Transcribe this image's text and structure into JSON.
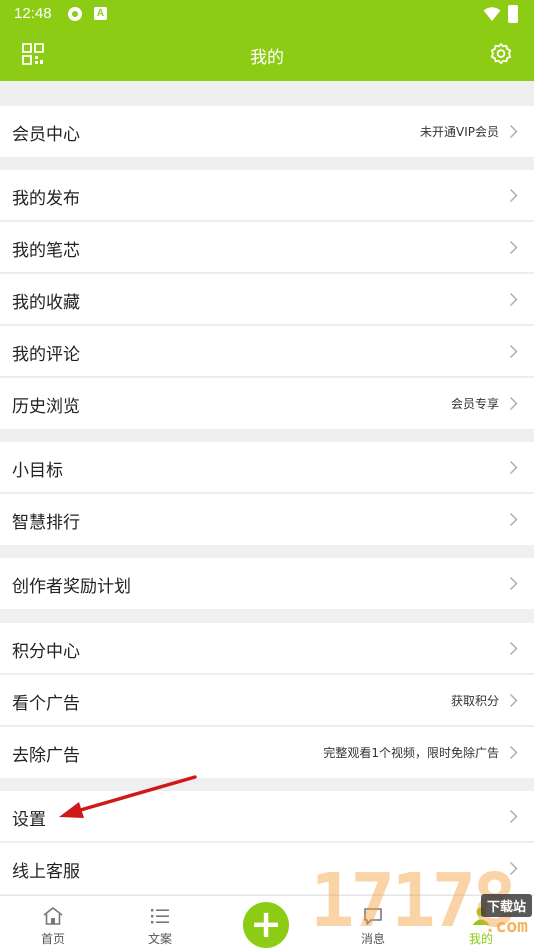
{
  "status_bar": {
    "time": "12:48",
    "icons": [
      "app-notification-icon",
      "a-badge-icon",
      "wifi-icon",
      "battery-icon"
    ],
    "badge_letter": "A"
  },
  "header": {
    "title": "我的",
    "left_icon": "qr-code-icon",
    "right_icon": "gear-icon"
  },
  "accent_color": "#8ccc14",
  "groups": [
    {
      "items": [
        {
          "label": "会员中心",
          "value": "未开通VIP会员"
        }
      ]
    },
    {
      "items": [
        {
          "label": "我的发布",
          "value": ""
        },
        {
          "label": "我的笔芯",
          "value": ""
        },
        {
          "label": "我的收藏",
          "value": ""
        },
        {
          "label": "我的评论",
          "value": ""
        },
        {
          "label": "历史浏览",
          "value": "会员专享"
        }
      ]
    },
    {
      "items": [
        {
          "label": "小目标",
          "value": ""
        },
        {
          "label": "智慧排行",
          "value": ""
        }
      ]
    },
    {
      "items": [
        {
          "label": "创作者奖励计划",
          "value": ""
        }
      ]
    },
    {
      "items": [
        {
          "label": "积分中心",
          "value": ""
        },
        {
          "label": "看个广告",
          "value": "获取积分"
        },
        {
          "label": "去除广告",
          "value": "完整观看1个视频，限时免除广告"
        }
      ]
    },
    {
      "items": [
        {
          "label": "设置",
          "value": ""
        },
        {
          "label": "线上客服",
          "value": ""
        }
      ]
    }
  ],
  "annotation": {
    "icon": "red-arrow-pointing-to-settings"
  },
  "tab_bar": {
    "tabs": [
      {
        "label": "首页",
        "icon": "home-icon"
      },
      {
        "label": "文案",
        "icon": "list-icon"
      },
      {
        "label": "",
        "icon": "plus-icon"
      },
      {
        "label": "消息",
        "icon": "message-icon"
      },
      {
        "label": "我的",
        "icon": "person-icon"
      }
    ]
  },
  "watermark": {
    "digits": "17178",
    "tag": "下载站",
    "suffix": ".com"
  }
}
